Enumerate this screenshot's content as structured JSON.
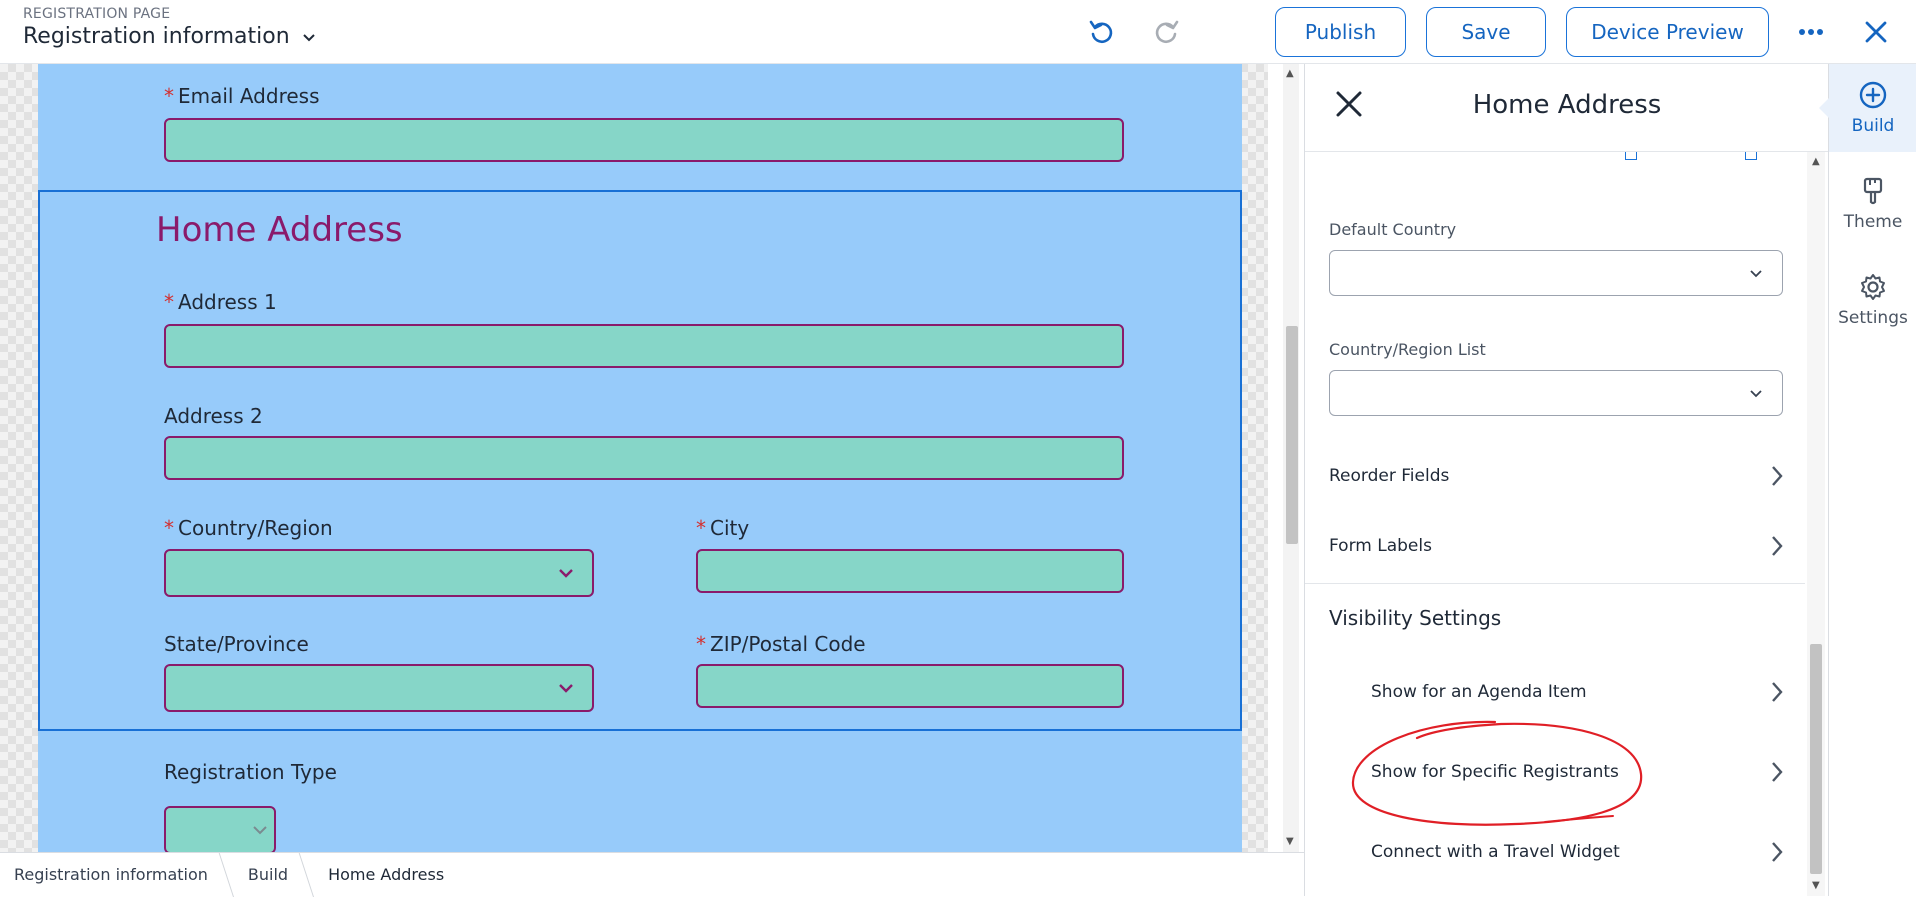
{
  "header": {
    "kicker": "REGISTRATION PAGE",
    "title": "Registration information",
    "publish_label": "Publish",
    "save_label": "Save",
    "device_preview_label": "Device Preview"
  },
  "form": {
    "email_label": "Email Address",
    "section_title": "Home Address",
    "address1_label": "Address 1",
    "address2_label": "Address 2",
    "country_label": "Country/Region",
    "city_label": "City",
    "state_label": "State/Province",
    "zip_label": "ZIP/Postal Code",
    "reg_type_label": "Registration Type",
    "required_mark": "*"
  },
  "breadcrumb": [
    "Registration information",
    "Build",
    "Home Address"
  ],
  "panel": {
    "title": "Home Address",
    "default_country_label": "Default Country",
    "country_list_label": "Country/Region List",
    "reorder_fields": "Reorder Fields",
    "form_labels": "Form Labels",
    "visibility_heading": "Visibility Settings",
    "visibility_items": [
      "Show for an Agenda Item",
      "Show for Specific Registrants",
      "Connect with a Travel Widget"
    ]
  },
  "rail": {
    "build": "Build",
    "theme": "Theme",
    "settings": "Settings"
  },
  "colors": {
    "accent": "#1565c0",
    "form_background": "#97cbfa",
    "field_fill": "#86d6c8",
    "field_border": "#8a1a6b",
    "annotation": "#e01f26"
  }
}
